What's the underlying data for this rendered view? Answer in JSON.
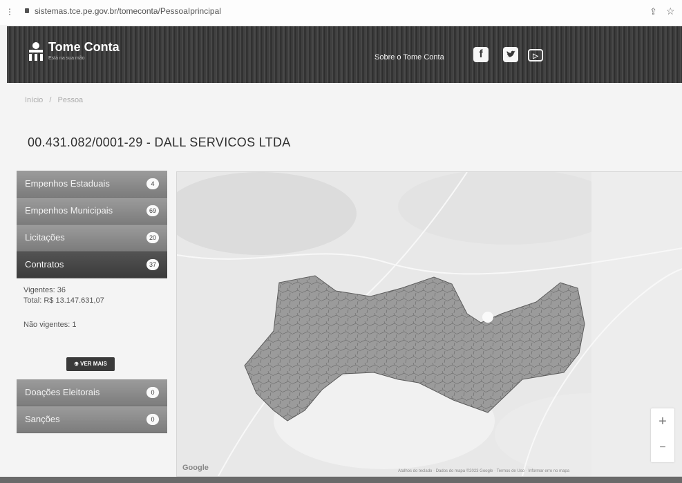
{
  "browser": {
    "url": "sistemas.tce.pe.gov.br/tomeconta/PessoaIprincipal"
  },
  "header": {
    "logo_title": "Tome Conta",
    "logo_subtitle": "Está na sua mão",
    "nav_sobre": "Sobre o Tome Conta",
    "social": [
      "facebook-icon",
      "twitter-icon",
      "youtube-icon"
    ]
  },
  "breadcrumb": [
    "Início",
    "Pessoa"
  ],
  "page_title": "00.431.082/0001-29 - DALL SERVICOS LTDA",
  "menu_top": [
    {
      "label": "Empenhos Estaduais",
      "count": "4"
    },
    {
      "label": "Empenhos Municipais",
      "count": "69"
    },
    {
      "label": "Licitações",
      "count": "20"
    },
    {
      "label": "Contratos",
      "count": "37"
    }
  ],
  "contracts": {
    "vigentes": "Vigentes: 36",
    "total": "Total: R$ 13.147.631,07",
    "nao_vigentes": "Não vigentes: 1",
    "ver_mais": "VER MAIS"
  },
  "menu_bottom": [
    {
      "label": "Doações Eleitorais",
      "count": "0"
    },
    {
      "label": "Sanções",
      "count": "0"
    }
  ],
  "map": {
    "google": "Google",
    "zoom_in": "+",
    "zoom_out": "−",
    "attribution": "Atalhos do teclado · Dados do mapa ©2023 Google · Termos de Uso · Informar erro no mapa"
  }
}
